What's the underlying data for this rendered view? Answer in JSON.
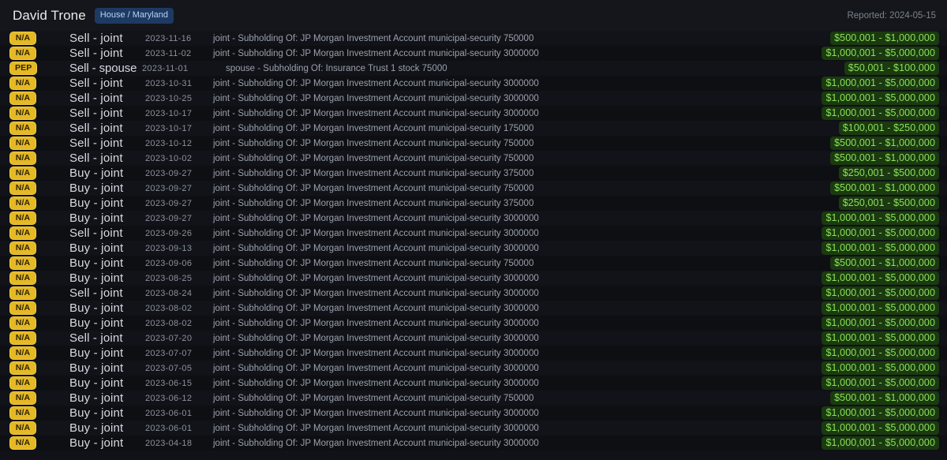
{
  "header": {
    "politician_name": "David Trone",
    "chamber_badge": "House / Maryland",
    "reported_label": "Reported: 2024-05-15"
  },
  "transactions": [
    {
      "tag": "N/A",
      "type": "Sell - joint",
      "date": "2023-11-16",
      "description": "joint - Subholding Of: JP Morgan Investment Account municipal-security 750000",
      "amount": "$500,001 - $1,000,000"
    },
    {
      "tag": "N/A",
      "type": "Sell - joint",
      "date": "2023-11-02",
      "description": "joint - Subholding Of: JP Morgan Investment Account municipal-security 3000000",
      "amount": "$1,000,001 - $5,000,000"
    },
    {
      "tag": "PEP",
      "type": "Sell - spouse",
      "date": "2023-11-01",
      "description": "spouse - Subholding Of: Insurance Trust 1 stock 75000",
      "amount": "$50,001 - $100,000"
    },
    {
      "tag": "N/A",
      "type": "Sell - joint",
      "date": "2023-10-31",
      "description": "joint - Subholding Of: JP Morgan Investment Account municipal-security 3000000",
      "amount": "$1,000,001 - $5,000,000"
    },
    {
      "tag": "N/A",
      "type": "Sell - joint",
      "date": "2023-10-25",
      "description": "joint - Subholding Of: JP Morgan Investment Account municipal-security 3000000",
      "amount": "$1,000,001 - $5,000,000"
    },
    {
      "tag": "N/A",
      "type": "Sell - joint",
      "date": "2023-10-17",
      "description": "joint - Subholding Of: JP Morgan Investment Account municipal-security 3000000",
      "amount": "$1,000,001 - $5,000,000"
    },
    {
      "tag": "N/A",
      "type": "Sell - joint",
      "date": "2023-10-17",
      "description": "joint - Subholding Of: JP Morgan Investment Account municipal-security 175000",
      "amount": "$100,001 - $250,000"
    },
    {
      "tag": "N/A",
      "type": "Sell - joint",
      "date": "2023-10-12",
      "description": "joint - Subholding Of: JP Morgan Investment Account municipal-security 750000",
      "amount": "$500,001 - $1,000,000"
    },
    {
      "tag": "N/A",
      "type": "Sell - joint",
      "date": "2023-10-02",
      "description": "joint - Subholding Of: JP Morgan Investment Account municipal-security 750000",
      "amount": "$500,001 - $1,000,000"
    },
    {
      "tag": "N/A",
      "type": "Buy - joint",
      "date": "2023-09-27",
      "description": "joint - Subholding Of: JP Morgan Investment Account municipal-security 375000",
      "amount": "$250,001 - $500,000"
    },
    {
      "tag": "N/A",
      "type": "Buy - joint",
      "date": "2023-09-27",
      "description": "joint - Subholding Of: JP Morgan Investment Account municipal-security 750000",
      "amount": "$500,001 - $1,000,000"
    },
    {
      "tag": "N/A",
      "type": "Buy - joint",
      "date": "2023-09-27",
      "description": "joint - Subholding Of: JP Morgan Investment Account municipal-security 375000",
      "amount": "$250,001 - $500,000"
    },
    {
      "tag": "N/A",
      "type": "Buy - joint",
      "date": "2023-09-27",
      "description": "joint - Subholding Of: JP Morgan Investment Account municipal-security 3000000",
      "amount": "$1,000,001 - $5,000,000"
    },
    {
      "tag": "N/A",
      "type": "Sell - joint",
      "date": "2023-09-26",
      "description": "joint - Subholding Of: JP Morgan Investment Account municipal-security 3000000",
      "amount": "$1,000,001 - $5,000,000"
    },
    {
      "tag": "N/A",
      "type": "Buy - joint",
      "date": "2023-09-13",
      "description": "joint - Subholding Of: JP Morgan Investment Account municipal-security 3000000",
      "amount": "$1,000,001 - $5,000,000"
    },
    {
      "tag": "N/A",
      "type": "Buy - joint",
      "date": "2023-09-06",
      "description": "joint - Subholding Of: JP Morgan Investment Account municipal-security 750000",
      "amount": "$500,001 - $1,000,000"
    },
    {
      "tag": "N/A",
      "type": "Buy - joint",
      "date": "2023-08-25",
      "description": "joint - Subholding Of: JP Morgan Investment Account municipal-security 3000000",
      "amount": "$1,000,001 - $5,000,000"
    },
    {
      "tag": "N/A",
      "type": "Sell - joint",
      "date": "2023-08-24",
      "description": "joint - Subholding Of: JP Morgan Investment Account municipal-security 3000000",
      "amount": "$1,000,001 - $5,000,000"
    },
    {
      "tag": "N/A",
      "type": "Buy - joint",
      "date": "2023-08-02",
      "description": "joint - Subholding Of: JP Morgan Investment Account municipal-security 3000000",
      "amount": "$1,000,001 - $5,000,000"
    },
    {
      "tag": "N/A",
      "type": "Buy - joint",
      "date": "2023-08-02",
      "description": "joint - Subholding Of: JP Morgan Investment Account municipal-security 3000000",
      "amount": "$1,000,001 - $5,000,000"
    },
    {
      "tag": "N/A",
      "type": "Sell - joint",
      "date": "2023-07-20",
      "description": "joint - Subholding Of: JP Morgan Investment Account municipal-security 3000000",
      "amount": "$1,000,001 - $5,000,000"
    },
    {
      "tag": "N/A",
      "type": "Buy - joint",
      "date": "2023-07-07",
      "description": "joint - Subholding Of: JP Morgan Investment Account municipal-security 3000000",
      "amount": "$1,000,001 - $5,000,000"
    },
    {
      "tag": "N/A",
      "type": "Buy - joint",
      "date": "2023-07-05",
      "description": "joint - Subholding Of: JP Morgan Investment Account municipal-security 3000000",
      "amount": "$1,000,001 - $5,000,000"
    },
    {
      "tag": "N/A",
      "type": "Buy - joint",
      "date": "2023-06-15",
      "description": "joint - Subholding Of: JP Morgan Investment Account municipal-security 3000000",
      "amount": "$1,000,001 - $5,000,000"
    },
    {
      "tag": "N/A",
      "type": "Buy - joint",
      "date": "2023-06-12",
      "description": "joint - Subholding Of: JP Morgan Investment Account municipal-security 750000",
      "amount": "$500,001 - $1,000,000"
    },
    {
      "tag": "N/A",
      "type": "Buy - joint",
      "date": "2023-06-01",
      "description": "joint - Subholding Of: JP Morgan Investment Account municipal-security 3000000",
      "amount": "$1,000,001 - $5,000,000"
    },
    {
      "tag": "N/A",
      "type": "Buy - joint",
      "date": "2023-06-01",
      "description": "joint - Subholding Of: JP Morgan Investment Account municipal-security 3000000",
      "amount": "$1,000,001 - $5,000,000"
    },
    {
      "tag": "N/A",
      "type": "Buy - joint",
      "date": "2023-04-18",
      "description": "joint - Subholding Of: JP Morgan Investment Account municipal-security 3000000",
      "amount": "$1,000,001 - $5,000,000"
    }
  ],
  "colors": {
    "tag_background": "#e5b824",
    "amount_text": "#8ce05a",
    "amount_background": "#1b3a10",
    "chamber_badge_background": "#1d3a63",
    "page_background": "#0e1014"
  }
}
